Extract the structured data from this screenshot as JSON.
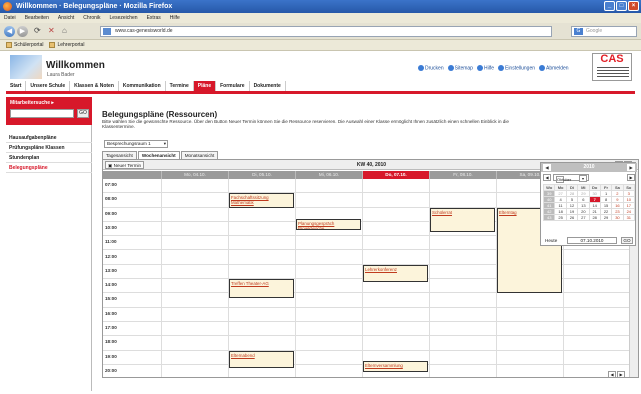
{
  "window": {
    "title": "Willkommen · Belegungspläne · Mozilla Firefox"
  },
  "menu": [
    "Datei",
    "Bearbeiten",
    "Ansicht",
    "Chronik",
    "Lesezeichen",
    "Extras",
    "Hilfe"
  ],
  "url": "www.cas-genesisworld.de",
  "search_placeholder": "Google",
  "bookmarks": [
    "Schülerportal",
    "Lehrerportal"
  ],
  "header": {
    "welcome": "Willkommen",
    "user": "Laura Bader",
    "links": [
      "Drucken",
      "Sitemap",
      "Hilfe",
      "Einstellungen",
      "Abmelden"
    ],
    "logo_text": "CAS"
  },
  "tabs": [
    "Start",
    "Unsere Schule",
    "Klassen & Noten",
    "Kommunikation",
    "Termine",
    "Pläne",
    "Formulare",
    "Dokumente"
  ],
  "active_tab": "Pläne",
  "sidebar": {
    "search_label": "Mitarbeitersuche ▸",
    "search_button": "GO",
    "items": [
      "Hausaufgabenpläne",
      "Prüfungspläne Klassen",
      "Stundenplan",
      "Belegungspläne"
    ]
  },
  "main": {
    "title": "Belegungspläne (Ressourcen)",
    "description": "Bitte wählen Sie die gewünschte Ressource. Über den Button Neuer Termin können Sie die Ressource reservieren. Die Auswahl einer Klasse ermöglicht Ihnen zusätzlich einen schnellen Einblick in die Klassentermine.",
    "resource_select": "Besprechungsraum 1",
    "view_tabs": [
      "Tagesansicht",
      "Wochenansicht",
      "Monatsansicht"
    ],
    "active_view": "Wochenansicht",
    "new_button": "Neuer Termin",
    "week_label": "KW 40, 2010",
    "days": [
      "Mo, 04.10.",
      "Di, 05.10.",
      "Mi, 06.10.",
      "Do, 07.10.",
      "Fr, 08.10.",
      "Sa, 09.10.",
      "So, 10.10."
    ],
    "today_index": 3,
    "hours": [
      "07:00",
      "08:00",
      "09:00",
      "10:00",
      "11:00",
      "12:00",
      "13:00",
      "14:00",
      "15:00",
      "16:00",
      "17:00",
      "18:00",
      "19:00",
      "20:00"
    ],
    "events": [
      {
        "day": 1,
        "start": 8.0,
        "end": 9.0,
        "label": "Fachschaftssitzung Mathematik"
      },
      {
        "day": 2,
        "start": 9.8,
        "end": 10.6,
        "label": "Planungsgespräch Projektwoche"
      },
      {
        "day": 4,
        "start": 9.0,
        "end": 10.7,
        "label": "Schülerrat"
      },
      {
        "day": 5,
        "start": 9.0,
        "end": 15.0,
        "label": "Elterntag"
      },
      {
        "day": 3,
        "start": 13.0,
        "end": 14.2,
        "label": "Lehrerkonferenz"
      },
      {
        "day": 1,
        "start": 14.0,
        "end": 15.3,
        "label": "Treffen Theater-AG"
      },
      {
        "day": 1,
        "start": 19.0,
        "end": 20.2,
        "label": "Elternabend"
      },
      {
        "day": 3,
        "start": 19.7,
        "end": 20.5,
        "label": "Elternversammlung"
      }
    ]
  },
  "minical": {
    "year": "2010",
    "month": "Oktober",
    "weekdays": [
      "Wo",
      "Mo",
      "Di",
      "Mi",
      "Do",
      "Fr",
      "Sa",
      "So"
    ],
    "weeks": [
      [
        "39",
        "27",
        "28",
        "29",
        "30",
        "1",
        "2",
        "3"
      ],
      [
        "40",
        "4",
        "5",
        "6",
        "7",
        "8",
        "9",
        "10"
      ],
      [
        "41",
        "11",
        "12",
        "13",
        "14",
        "15",
        "16",
        "17"
      ],
      [
        "42",
        "18",
        "19",
        "20",
        "21",
        "22",
        "23",
        "24"
      ],
      [
        "43",
        "25",
        "26",
        "27",
        "28",
        "29",
        "30",
        "31"
      ]
    ],
    "selected": "7",
    "today_label": "Heute",
    "today_value": "07.10.2010",
    "go": "GO"
  }
}
